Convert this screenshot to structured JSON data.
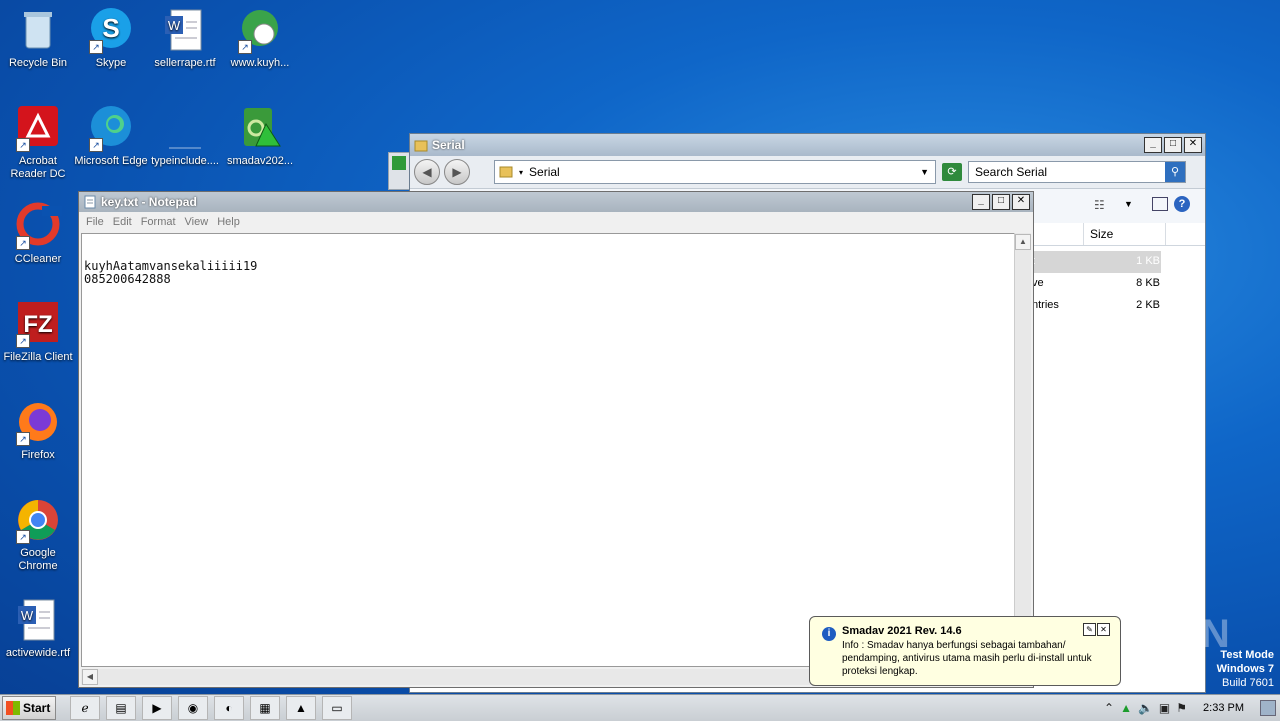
{
  "desktop": {
    "icons": [
      {
        "label": "Recycle Bin",
        "icon": "recycle-bin-icon"
      },
      {
        "label": "Skype",
        "icon": "skype-icon"
      },
      {
        "label": "sellerrape.rtf",
        "icon": "word-document-icon"
      },
      {
        "label": "www.kuyh...",
        "icon": "internet-shortcut-icon"
      },
      {
        "label": "Acrobat Reader DC",
        "icon": "acrobat-icon"
      },
      {
        "label": "Microsoft Edge",
        "icon": "edge-icon"
      },
      {
        "label": "typeinclude....",
        "icon": "blank-file-icon"
      },
      {
        "label": "smadav202...",
        "icon": "smadav-icon"
      },
      {
        "label": "CCleaner",
        "icon": "ccleaner-icon"
      },
      {
        "label": "FileZilla Client",
        "icon": "filezilla-icon"
      },
      {
        "label": "Firefox",
        "icon": "firefox-icon"
      },
      {
        "label": "Google Chrome",
        "icon": "chrome-icon"
      },
      {
        "label": "activewide.rtf",
        "icon": "word-document-icon"
      }
    ]
  },
  "explorer": {
    "title": "Serial",
    "address": "Serial",
    "search_placeholder": "Search Serial",
    "columns": {
      "size": "Size"
    },
    "rows": [
      {
        "name_fragment": "t",
        "size": "1 KB"
      },
      {
        "name_fragment": "ve",
        "size": "8 KB"
      },
      {
        "name_fragment": "ntries",
        "size": "2 KB"
      }
    ]
  },
  "notepad": {
    "title": "key.txt - Notepad",
    "menu": [
      "File",
      "Edit",
      "Format",
      "View",
      "Help"
    ],
    "content": "kuyhAatamvansekaliiiii19\n085200642888"
  },
  "popup": {
    "title": "Smadav 2021 Rev. 14.6",
    "body": "Info : Smadav hanya berfungsi sebagai tambahan/ pendamping, antivirus utama masih perlu di-install untuk proteksi lengkap."
  },
  "watermark": "ANY.RUN",
  "test_mode": {
    "line1": "Test Mode",
    "line2": "Windows 7",
    "line3": "Build 7601"
  },
  "taskbar": {
    "start_label": "Start",
    "clock": "2:33 PM",
    "pinned": [
      "ie-icon",
      "folder-icon",
      "media-player-icon",
      "chrome-icon",
      "edge-icon",
      "winrar-icon",
      "smadav-icon",
      "notepad-icon"
    ]
  }
}
